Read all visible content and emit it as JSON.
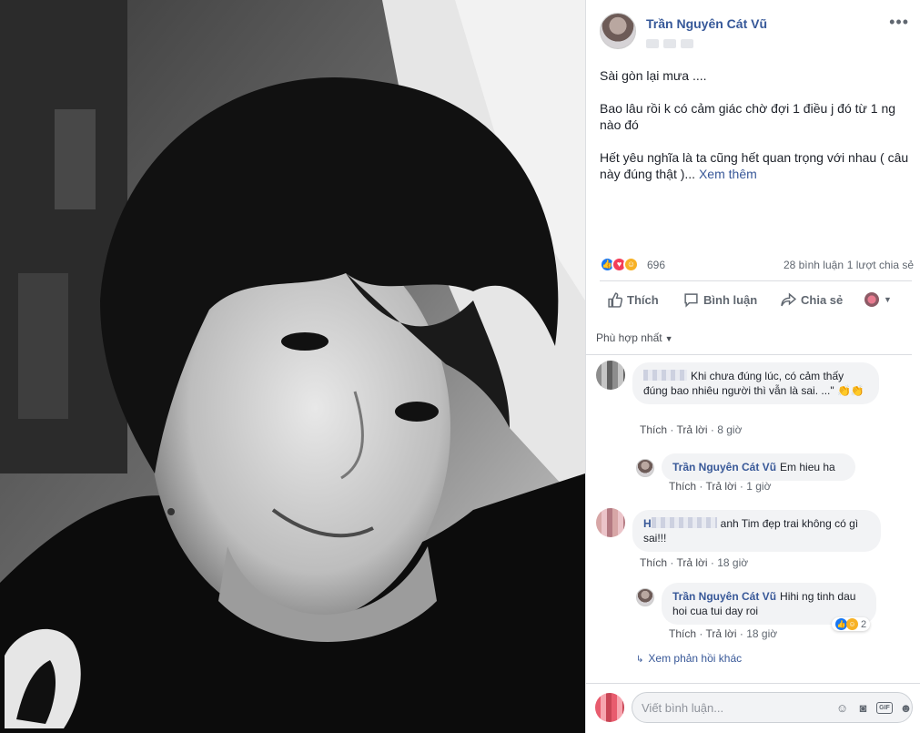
{
  "post": {
    "author": "Trần Nguyên Cát Vũ",
    "text": {
      "p1": "Sài gòn lại mưa ....",
      "p2": "Bao lâu rồi k có cảm giác chờ đợi 1 điều j đó từ 1 ng nào đó",
      "p3": "Hết yêu nghĩa là ta cũng hết quan trọng với nhau ( câu này đúng thật )...",
      "see_more": "Xem thêm"
    },
    "more_icon": "more-dots-icon"
  },
  "stats": {
    "reactions": "696",
    "comments": "28 bình luận",
    "shares": "1 lượt chia sẻ"
  },
  "actions": {
    "like": "Thích",
    "comment": "Bình luận",
    "share": "Chia sẻ"
  },
  "comments": {
    "filter_label": "Phù hợp nhất",
    "items": [
      {
        "text": "Khi chưa đúng lúc, có cảm thấy đúng bao nhiêu người thì vẫn là sai. ...\"",
        "like": "Thích",
        "reply": "Trả lời",
        "time": "8 giờ"
      },
      {
        "author": "Trần Nguyên Cát Vũ",
        "text": "Em hieu ha",
        "like": "Thích",
        "reply": "Trả lời",
        "time": "1 giờ"
      },
      {
        "prefix": "H",
        "text": "anh Tim đẹp trai không có gì sai!!!",
        "like": "Thích",
        "reply": "Trả lời",
        "time": "18 giờ"
      },
      {
        "author": "Trần Nguyên Cát Vũ",
        "text": "Hihi ng tinh dau hoi cua tui day roi",
        "like": "Thích",
        "reply": "Trả lời",
        "time": "18 giờ",
        "reactions": "2"
      }
    ],
    "more_replies": "Xem phản hồi khác"
  },
  "composer": {
    "placeholder": "Viết bình luận...",
    "gif_label": "GIF"
  },
  "colors": {
    "link": "#385898",
    "name": "#365899",
    "like_blue": "#1877f2",
    "love_red": "#f33e58",
    "haha_yellow": "#f7b125"
  }
}
